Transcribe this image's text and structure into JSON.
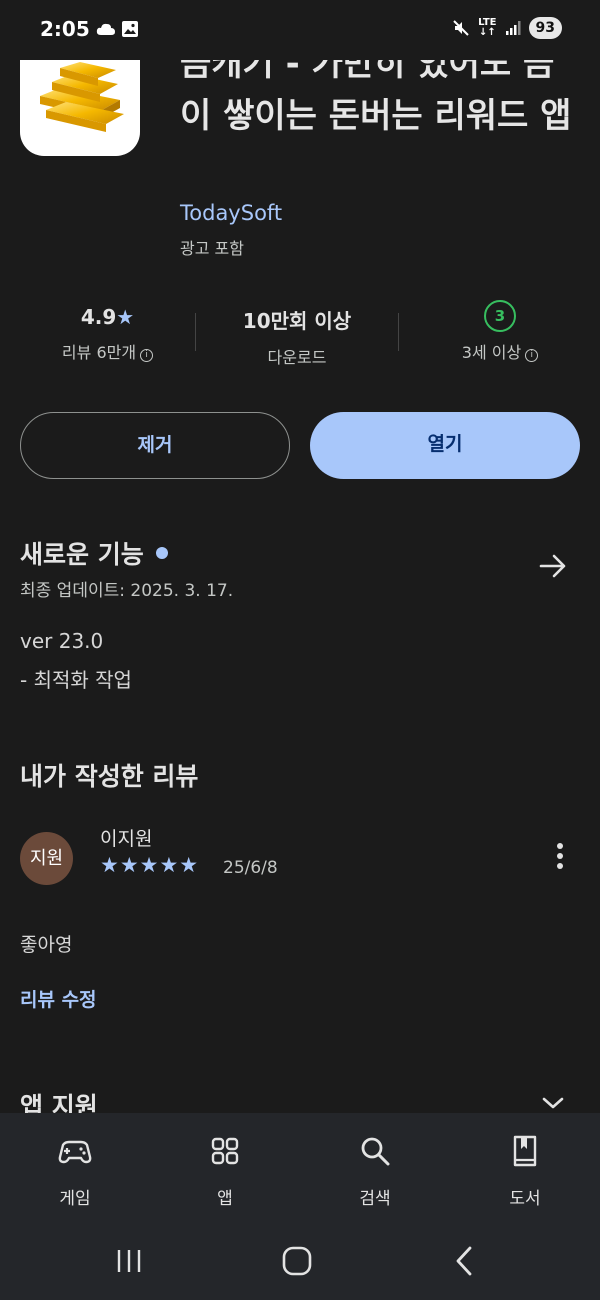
{
  "status_bar": {
    "time": "2:05",
    "network": "LTE",
    "battery": "93"
  },
  "app": {
    "title": "금캐기 - 가만히 있어도 금이 쌓이는 돈버는 리워드 앱",
    "developer": "TodaySoft",
    "ads_label": "광고 포함"
  },
  "stats": {
    "rating_value": "4.9",
    "rating_star": "★",
    "rating_label": "리뷰 6만개",
    "downloads_value": "10만회 이상",
    "downloads_label": "다운로드",
    "age_badge": "3",
    "age_label": "3세 이상"
  },
  "actions": {
    "remove_label": "제거",
    "open_label": "열기"
  },
  "whats_new": {
    "title": "새로운 기능",
    "date": "최종 업데이트: 2025. 3. 17.",
    "notes": [
      "ver 23.0",
      "- 최적화 작업"
    ]
  },
  "my_review": {
    "title": "내가 작성한 리뷰",
    "avatar_text": "지원",
    "reviewer": "이지원",
    "stars": "★★★★★",
    "rating": 5,
    "date": "25/6/8",
    "text": "좋아영",
    "edit_label": "리뷰 수정"
  },
  "app_support": {
    "title": "앱 지원"
  },
  "bottom_nav": [
    {
      "label": "게임",
      "icon": "gamepad-icon"
    },
    {
      "label": "앱",
      "icon": "apps-grid-icon"
    },
    {
      "label": "검색",
      "icon": "search-icon"
    },
    {
      "label": "도서",
      "icon": "book-icon"
    }
  ],
  "colors": {
    "background": "#1b1b1b",
    "accent": "#a8c7fa",
    "button_text_dark": "#062e6f",
    "age_green": "#37be5f",
    "nav_background": "#24262a"
  }
}
